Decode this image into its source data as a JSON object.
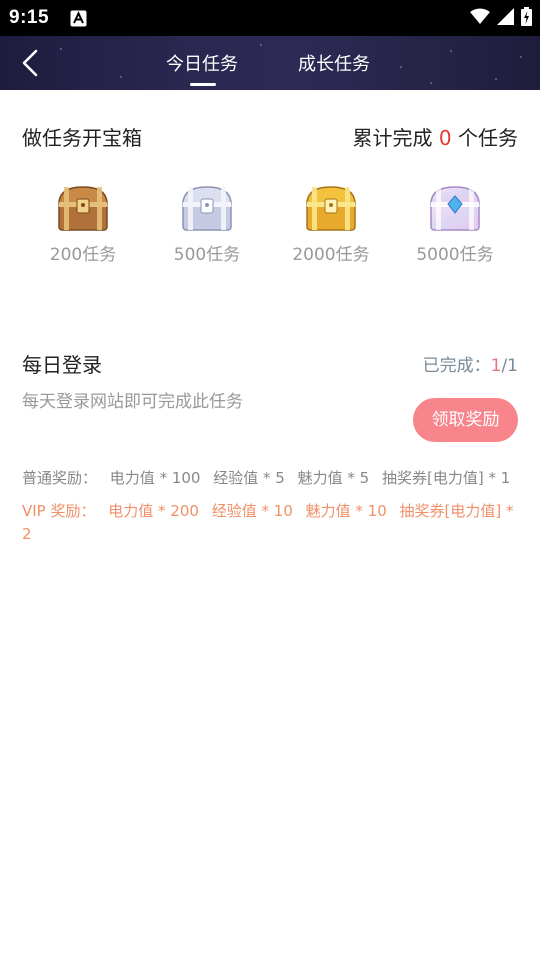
{
  "status_bar": {
    "time": "9:15"
  },
  "header": {
    "tabs": [
      {
        "label": "今日任务",
        "active": true
      },
      {
        "label": "成长任务",
        "active": false
      }
    ]
  },
  "treasure": {
    "title": "做任务开宝箱",
    "total_prefix": "累计完成 ",
    "total_count": "0",
    "total_suffix": " 个任务",
    "chests": [
      {
        "label": "200任务",
        "icon": "bronze-chest-icon"
      },
      {
        "label": "500任务",
        "icon": "silver-chest-icon"
      },
      {
        "label": "2000任务",
        "icon": "gold-chest-icon"
      },
      {
        "label": "5000任务",
        "icon": "diamond-chest-icon"
      }
    ]
  },
  "task": {
    "title": "每日登录",
    "progress_prefix": "已完成：",
    "progress_done": "1",
    "progress_total": "/1",
    "description": "每天登录网站即可完成此任务",
    "claim_label": "领取奖励",
    "normal_reward": {
      "label": "普通奖励：",
      "items": [
        "电力值 * 100",
        "经验值 * 5",
        "魅力值 * 5",
        "抽奖券[电力值] * 1"
      ]
    },
    "vip_reward": {
      "label": "VIP 奖励：",
      "items": [
        "电力值 * 200",
        "经验值 * 10",
        "魅力值 * 10",
        "抽奖券[电力值] * 2"
      ]
    }
  },
  "colors": {
    "header_bg": "#2a2850",
    "accent_red": "#e53935",
    "claim_button": "#f8848c",
    "vip_text": "#f09068"
  }
}
